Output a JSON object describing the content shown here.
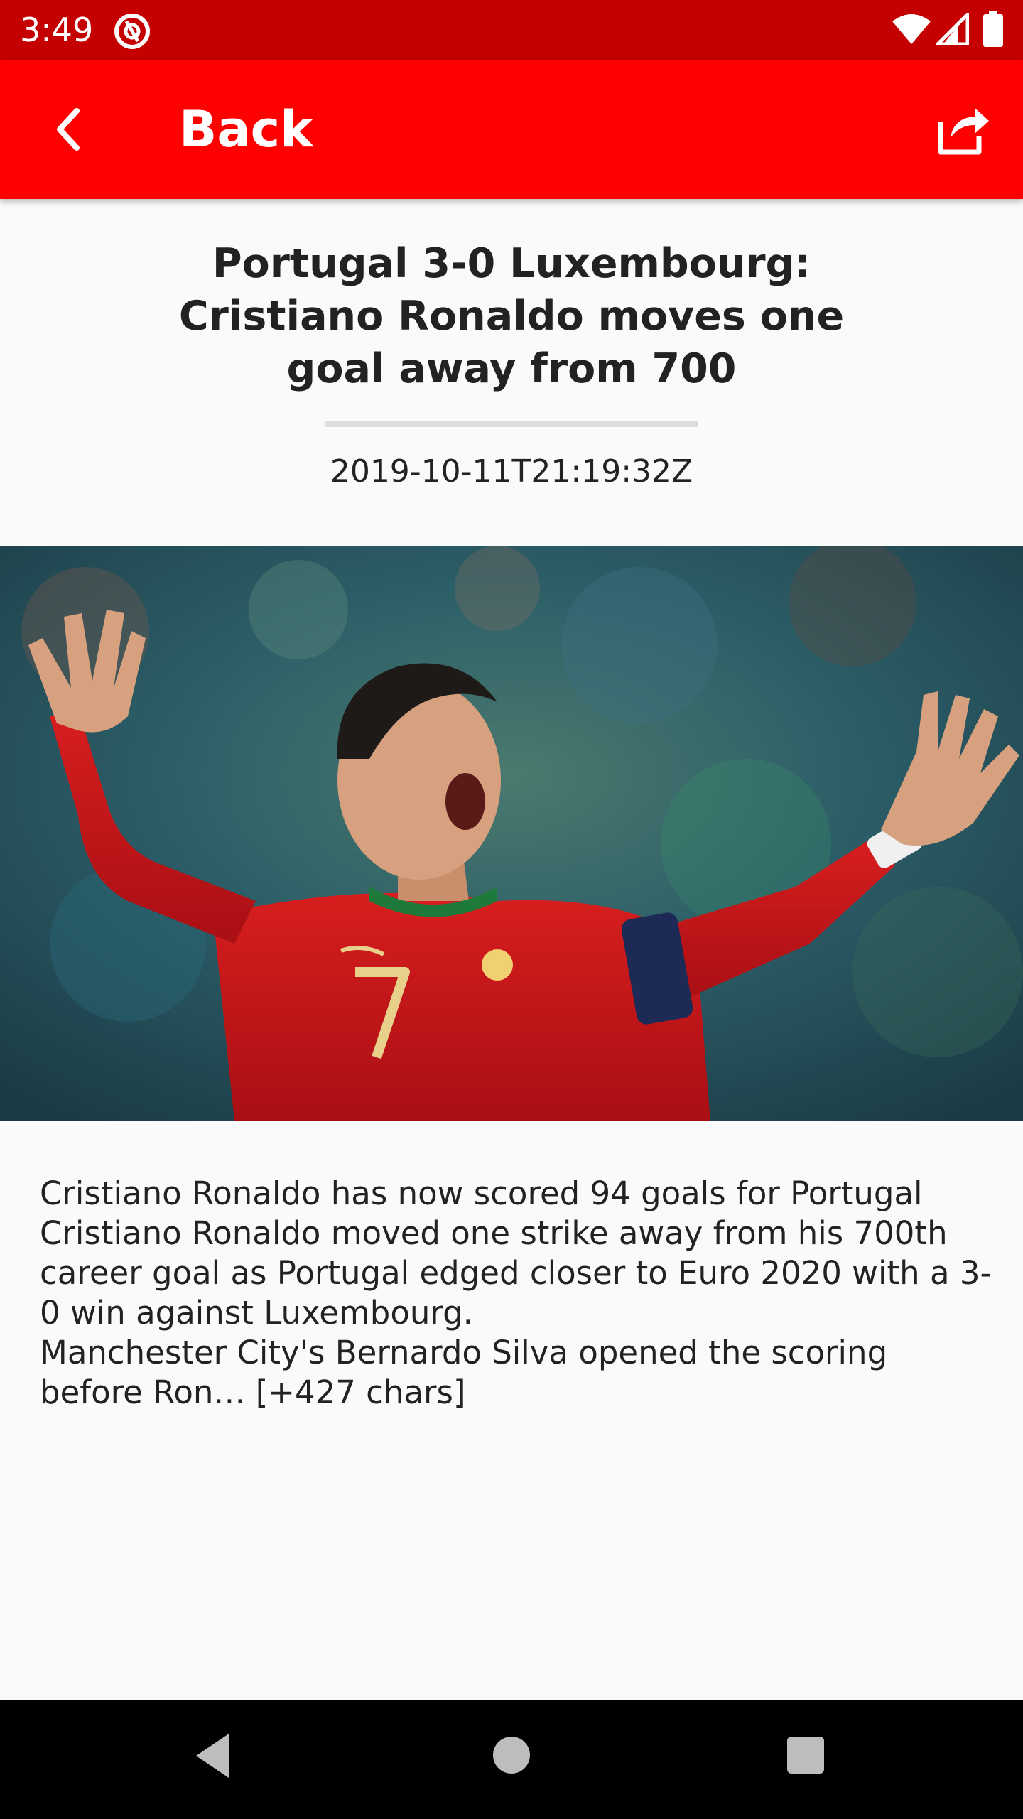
{
  "status_bar": {
    "time": "3:49",
    "icons": [
      "notification-icon",
      "wifi-icon",
      "signal-icon",
      "battery-icon"
    ],
    "background_color": "#c40000"
  },
  "app_bar": {
    "title": "Back",
    "back_icon": "chevron-left-icon",
    "share_icon": "share-icon",
    "background_color": "#ff0000"
  },
  "article": {
    "title": "Portugal 3-0 Luxembourg: Cristiano Ronaldo moves one goal away from 700",
    "date": "2019-10-11T21:19:32Z",
    "image_subject": "football-player-celebrating-photo",
    "body_lines": [
      "Cristiano Ronaldo has now scored 94 goals for Portugal",
      "Cristiano Ronaldo moved one strike away from his 700th career goal as Portugal edged closer to Euro 2020 with a 3-0 win against Luxembourg.",
      "Manchester City's Bernardo Silva opened the scoring before Ron… [+427 chars]"
    ]
  },
  "nav_bar": {
    "buttons": [
      "back-triangle-icon",
      "home-circle-icon",
      "recents-square-icon"
    ]
  }
}
